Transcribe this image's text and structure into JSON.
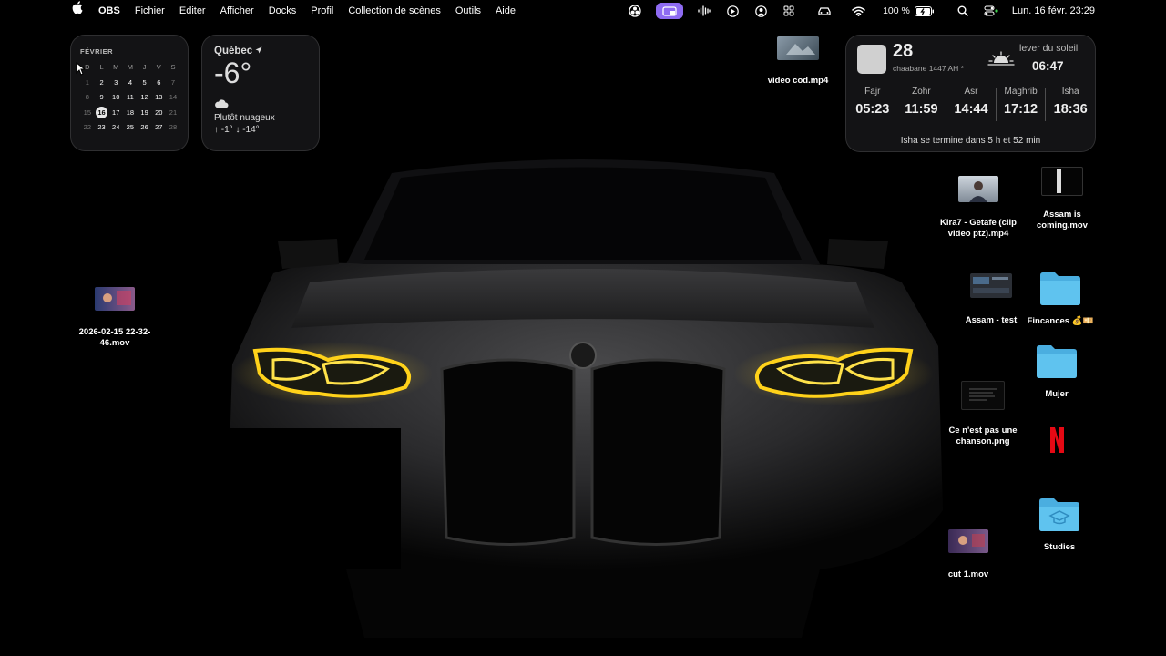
{
  "menubar": {
    "apple": "",
    "app": "OBS",
    "menus": [
      "Fichier",
      "Editer",
      "Afficher",
      "Docks",
      "Profil",
      "Collection de scènes",
      "Outils",
      "Aide"
    ],
    "battery": "100 %",
    "datetime": "Lun. 16 févr. 23:29"
  },
  "calendar": {
    "month": "FÉVRIER",
    "headers": [
      "D",
      "L",
      "M",
      "M",
      "J",
      "V",
      "S"
    ],
    "weeks": [
      [
        "1",
        "2",
        "3",
        "4",
        "5",
        "6",
        "7"
      ],
      [
        "8",
        "9",
        "10",
        "11",
        "12",
        "13",
        "14"
      ],
      [
        "15",
        "16",
        "17",
        "18",
        "19",
        "20",
        "21"
      ],
      [
        "22",
        "23",
        "24",
        "25",
        "26",
        "27",
        "28"
      ]
    ],
    "today": "16"
  },
  "weather": {
    "city": "Québec",
    "temp": "-6°",
    "condition": "Plutôt nuageux",
    "highlow": "↑ -1° ↓ -14°"
  },
  "prayer": {
    "day": "28",
    "hijri": "chaabane 1447 AH *",
    "sunrise_label": "lever du soleil",
    "sunrise_time": "06:47",
    "times": [
      {
        "name": "Fajr",
        "time": "05:23"
      },
      {
        "name": "Zohr",
        "time": "11:59"
      },
      {
        "name": "Asr",
        "time": "14:44"
      },
      {
        "name": "Maghrib",
        "time": "17:12"
      },
      {
        "name": "Isha",
        "time": "18:36"
      }
    ],
    "footer": "Isha se termine dans 5 h et 52 min"
  },
  "desktop": {
    "video_cod": "video cod.mp4",
    "kira": "Kira7 - Getafe (clip video ptz).mp4",
    "assam_coming": "Assam is coming.mov",
    "assam_test": "Assam - test",
    "fincances": "Fincances 💰💴",
    "mujer": "Mujer",
    "chanson": "Ce n'est pas une chanson.png",
    "netflix": "",
    "studies": "Studies",
    "cut": "cut 1.mov",
    "recording": "2026-02-15 22-32-46.mov"
  },
  "colors": {
    "accent_pill": "#8e6bf2",
    "folder": "#5fc3ef",
    "headlight": "#ffd21a"
  }
}
